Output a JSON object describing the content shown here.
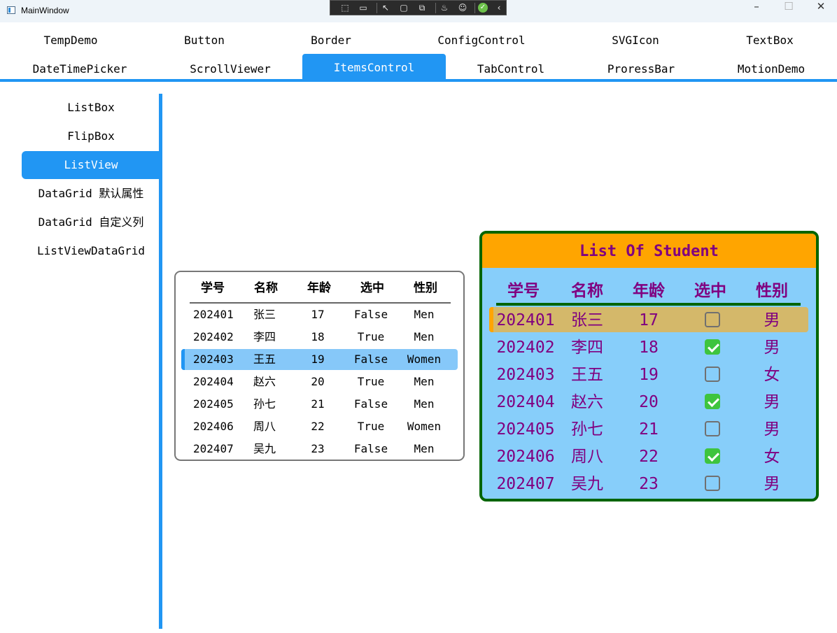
{
  "window": {
    "title": "MainWindow"
  },
  "tabs_row1": [
    "TempDemo",
    "Button",
    "Border",
    "ConfigControl",
    "SVGIcon",
    "TextBox"
  ],
  "tabs_row2": [
    "DateTimePicker",
    "ScrollViewer",
    "ItemsControl",
    "TabControl",
    "ProressBar",
    "MotionDemo"
  ],
  "selected_tab": "ItemsControl",
  "sidebar": {
    "items": [
      "ListBox",
      "FlipBox",
      "ListView",
      "DataGrid 默认属性",
      "DataGrid 自定义列",
      "ListViewDataGrid"
    ],
    "selected": "ListView"
  },
  "list1": {
    "headers": [
      "学号",
      "名称",
      "年龄",
      "选中",
      "性别"
    ],
    "rows": [
      [
        "202401",
        "张三",
        "17",
        "False",
        "Men"
      ],
      [
        "202402",
        "李四",
        "18",
        "True",
        "Men"
      ],
      [
        "202403",
        "王五",
        "19",
        "False",
        "Women"
      ],
      [
        "202404",
        "赵六",
        "20",
        "True",
        "Men"
      ],
      [
        "202405",
        "孙七",
        "21",
        "False",
        "Men"
      ],
      [
        "202406",
        "周八",
        "22",
        "True",
        "Women"
      ],
      [
        "202407",
        "吴九",
        "23",
        "False",
        "Men"
      ]
    ],
    "selected_index": 2
  },
  "list2": {
    "title": "List Of Student",
    "headers": [
      "学号",
      "名称",
      "年龄",
      "选中",
      "性别"
    ],
    "rows": [
      {
        "id": "202401",
        "name": "张三",
        "age": "17",
        "checked": false,
        "sex": "男"
      },
      {
        "id": "202402",
        "name": "李四",
        "age": "18",
        "checked": true,
        "sex": "男"
      },
      {
        "id": "202403",
        "name": "王五",
        "age": "19",
        "checked": false,
        "sex": "女"
      },
      {
        "id": "202404",
        "name": "赵六",
        "age": "20",
        "checked": true,
        "sex": "男"
      },
      {
        "id": "202405",
        "name": "孙七",
        "age": "21",
        "checked": false,
        "sex": "男"
      },
      {
        "id": "202406",
        "name": "周八",
        "age": "22",
        "checked": true,
        "sex": "女"
      },
      {
        "id": "202407",
        "name": "吴九",
        "age": "23",
        "checked": false,
        "sex": "男"
      }
    ],
    "selected_index": 0
  },
  "colors": {
    "accent": "#2196f3",
    "list2_border": "#006400",
    "list2_banner": "#ffa500",
    "list2_background": "#87cefa",
    "list2_text": "#800080",
    "checkbox_on": "#3ec43e"
  },
  "icons": {
    "debug_toolbar": [
      "select-element-icon",
      "video-icon",
      "pointer-icon",
      "bounds-icon",
      "track-focus-icon",
      "hot-reload-icon",
      "accessibility-icon",
      "check-ok-icon",
      "collapse-icon"
    ],
    "window_controls": [
      "minimize-icon",
      "maximize-icon",
      "close-icon"
    ]
  }
}
